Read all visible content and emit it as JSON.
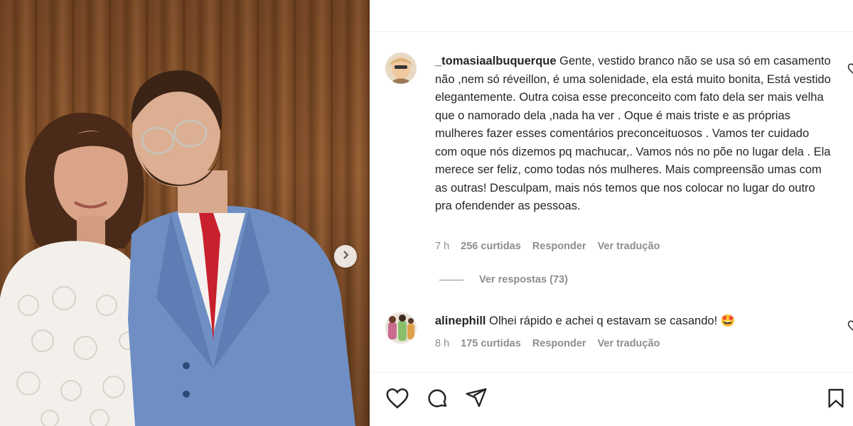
{
  "post": {
    "photo_alt_icon": "photo-carousel",
    "next_icon": "chevron-right-icon"
  },
  "comments": [
    {
      "username": "_tomasiaalbuquerque",
      "text": "Gente, vestido branco não se usa só em casamento não ,nem só réveillon, é uma solenidade, ela está muito bonita, Está vestido elegantemente. Outra coisa esse preconceito com fato dela ser mais velha que o namorado dela ,nada ha ver . Oque é mais triste e as próprias mulheres fazer esses comentários preconceituosos . Vamos ter cuidado com oque nós dizemos pq machucar,. Vamos nós no põe no lugar dela . Ela merece ser feliz, como todas nós mulheres. Mais compreensão umas com as outras! Desculpam, mais nós temos que nos colocar no lugar do outro pra ofendender as pessoas.",
      "time": "7 h",
      "likes": "256 curtidas",
      "reply": "Responder",
      "translate": "Ver tradução",
      "view_replies": "Ver respostas (73)"
    },
    {
      "username": "alinephill",
      "text": "Olhei rápido e achei q estavam se casando! 🤩",
      "time": "8 h",
      "likes": "175 curtidas",
      "reply": "Responder",
      "translate": "Ver tradução"
    }
  ],
  "actions": {
    "like_icon": "heart-icon",
    "comment_icon": "comment-icon",
    "share_icon": "send-icon",
    "save_icon": "bookmark-icon"
  }
}
